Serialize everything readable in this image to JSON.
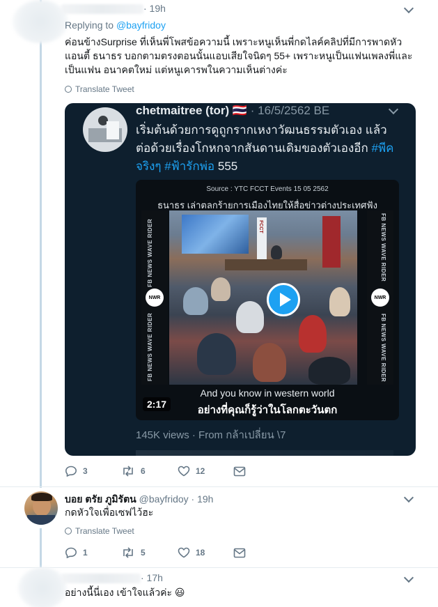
{
  "tweet1": {
    "time": "· 19h",
    "replying_prefix": "Replying to",
    "replying_handle": "@bayfridoy",
    "text": "ค่อนข้างSurprise ที่เห็นพี่โพสข้อความนี้ เพราะหนูเห็นพี่กดไลค์คลิปที่มีการพาดหัวแอนตี้ ธนาธร บอกตามตรงตอนนั้นแอบเสียใจนิดๆ 55+ เพราะหนูเป็นแฟนเพลงพี่และเป็นแฟน อนาคตใหม่ แต่หนูเคารพในความเห็นต่างค่ะ",
    "translate": "Translate Tweet",
    "replies": "3",
    "retweets": "6",
    "likes": "12"
  },
  "quoted": {
    "name": "chetmaitree (tor)",
    "flag": "🇹🇭",
    "date": "· 16/5/2562 BE",
    "text_plain": "เริ่มต้นด้วยการดูถูกรากเหงาวัฒนธรรมตัวเอง แล้วต่อด้วยเรื่องโกหกจากสันดานเดิมของตัวเองอีก",
    "hashtag1": "#พีคจริงๆ",
    "hashtag2": "#ฟ้ารักพ่อ",
    "text_end": "555",
    "video_source": "Source : YTC FCCT Events 15 05 2562",
    "video_title": "ธนาธร เล่าตลกร้ายการเมืองไทยให้สื่อข่าวต่างประเทศฟัง",
    "side_label": "FB NEWS WAVE RIDER",
    "nwr": "NWR",
    "screen_brand": "FCCT",
    "subtitle_en": "And you know in western world",
    "subtitle_th": "อย่างที่คุณก็รู้ว่าในโลกตะวันตก",
    "duration": "2:17",
    "views": "145K views · From กล้าเปลี่ยน \\7"
  },
  "tweet2": {
    "name": "บอย ตรัย ภูมิรัตน",
    "handle": "@bayfridoy · 19h",
    "text": "กดหัวใจเพื่อเซฟไว้ฮะ",
    "translate": "Translate Tweet",
    "replies": "1",
    "retweets": "5",
    "likes": "18"
  },
  "tweet3": {
    "time": "· 17h",
    "text": "อย่างนี้นี่เอง เข้าใจแล้วค่ะ",
    "emoji": "😃"
  },
  "colors": {
    "accent": "#1da1f2",
    "muted": "#657786",
    "thread": "#c4d8e6",
    "embed_bg": "#0e1f2e"
  }
}
